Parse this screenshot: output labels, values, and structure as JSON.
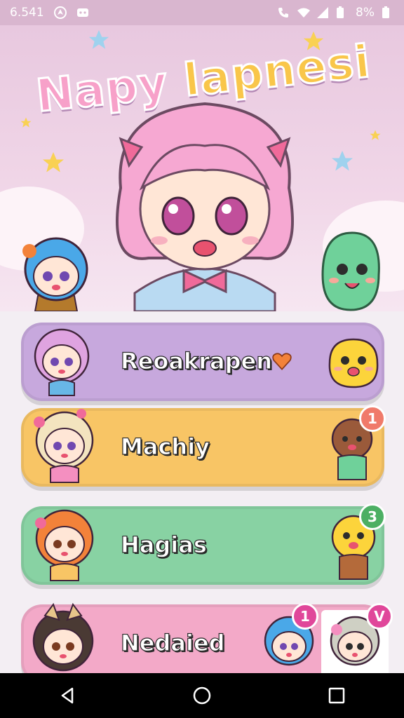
{
  "status_bar": {
    "time": "6.541",
    "battery": "8%",
    "icons": [
      "navigation-icon",
      "notification-icon",
      "phone-icon",
      "wifi-icon",
      "signal-icon",
      "battery-icon"
    ]
  },
  "hero": {
    "title_part1": "Napy",
    "title_part2": "lapnesi"
  },
  "cards": [
    {
      "label": "Reoakrapen",
      "color": "#c7a8dd",
      "badge": ""
    },
    {
      "label": "Machiy",
      "color": "#f8c565",
      "badge": "1",
      "badge_color": "#f07a6a"
    },
    {
      "label": "Hagias",
      "color": "#88d2a3",
      "badge": "3",
      "badge_color": "#4caf63"
    },
    {
      "label": "Nedaied",
      "color": "#f3a9c8",
      "badge": "1",
      "badge_color": "#e0479a",
      "badge2": "V",
      "badge2_color": "#e0479a"
    }
  ],
  "nav": {
    "icons": [
      "back-icon",
      "home-icon",
      "recents-icon"
    ]
  }
}
